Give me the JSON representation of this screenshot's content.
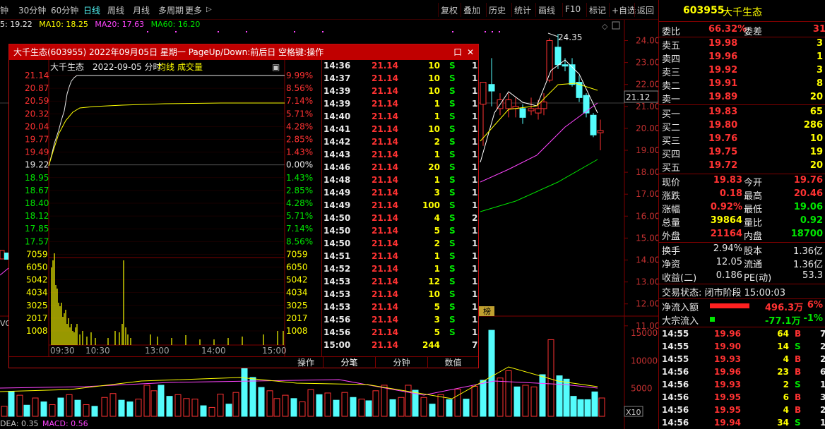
{
  "toolbar": {
    "tabs": [
      "钟",
      "30分钟",
      "60分钟",
      "日线",
      "周线",
      "月线",
      "多周期",
      "更多"
    ],
    "active": "日线",
    "more_arrow": "▷",
    "buttons": [
      "复权",
      "叠加",
      "历史",
      "统计",
      "画线",
      "F10",
      "标记",
      "+自选",
      "返回"
    ]
  },
  "ma_bar": {
    "ma5": "5: 19.22",
    "ma10": "MA10: 18.25",
    "ma20": "MA20: 17.63",
    "ma60": "MA60: 16.20"
  },
  "kline": {
    "price_axis": [
      "24.00",
      "23.00",
      "22.00",
      "21.00",
      "20.00",
      "19.00",
      "18.00",
      "17.00",
      "16.00",
      "15.00",
      "14.00",
      "13.00",
      "12.00",
      "11.00"
    ],
    "current_price_label": "21.12",
    "high_label": "24.35",
    "volume_axis": [
      "15000",
      "10000",
      "5000"
    ],
    "volume_unit": "X10",
    "bang_label": "榜",
    "indicator": {
      "dea": "DEA: 0.35",
      "macd": "MACD: 0.56"
    },
    "vol_left": "VOL",
    "colors": {
      "up": "#ff3232",
      "down": "#54fcfc",
      "ma5": "#ffffff",
      "ma10": "#ffff00",
      "ma20": "#ff44ff",
      "ma60": "#00e600"
    }
  },
  "popup": {
    "title": "大千生态(603955) 2022年09月05日 星期一 PageUp/Down:前后日 空格键:操作",
    "min_btn": "口",
    "close_btn": "✕",
    "intraday": {
      "name": "大千生态",
      "date_label": "2022-09-05 分时",
      "avg_label": "均线",
      "vol_label": "成交量",
      "corner_btn": "▣",
      "left_prices": [
        "21.14",
        "20.87",
        "20.59",
        "20.32",
        "20.04",
        "19.77",
        "19.49",
        "19.22",
        "18.95",
        "18.67",
        "18.40",
        "18.12",
        "17.85",
        "17.57"
      ],
      "right_pct": [
        "9.99%",
        "8.56%",
        "7.14%",
        "5.71%",
        "4.28%",
        "2.85%",
        "1.43%",
        "0.00%",
        "1.43%",
        "2.85%",
        "4.28%",
        "5.71%",
        "7.14%",
        "8.56%"
      ],
      "vol_axis": [
        "7059",
        "6050",
        "5042",
        "4034",
        "3025",
        "2017",
        "1008"
      ],
      "time_axis": [
        "09:30",
        "10:30",
        "13:00",
        "14:00",
        "15:00"
      ]
    },
    "ticks": [
      {
        "time": "14:36",
        "price": "21.14",
        "vol": "10",
        "side": "S",
        "n": "1"
      },
      {
        "time": "14:37",
        "price": "21.14",
        "vol": "10",
        "side": "S",
        "n": "1"
      },
      {
        "time": "14:39",
        "price": "21.14",
        "vol": "10",
        "side": "S",
        "n": "1"
      },
      {
        "time": "14:39",
        "price": "21.14",
        "vol": "1",
        "side": "S",
        "n": "1"
      },
      {
        "time": "14:40",
        "price": "21.14",
        "vol": "1",
        "side": "S",
        "n": "1"
      },
      {
        "time": "14:41",
        "price": "21.14",
        "vol": "10",
        "side": "S",
        "n": "1"
      },
      {
        "time": "14:42",
        "price": "21.14",
        "vol": "2",
        "side": "S",
        "n": "1"
      },
      {
        "time": "14:43",
        "price": "21.14",
        "vol": "1",
        "side": "S",
        "n": "1"
      },
      {
        "time": "14:46",
        "price": "21.14",
        "vol": "20",
        "side": "S",
        "n": "1"
      },
      {
        "time": "14:48",
        "price": "21.14",
        "vol": "1",
        "side": "S",
        "n": "1"
      },
      {
        "time": "14:49",
        "price": "21.14",
        "vol": "3",
        "side": "S",
        "n": "1"
      },
      {
        "time": "14:49",
        "price": "21.14",
        "vol": "100",
        "side": "S",
        "n": "1"
      },
      {
        "time": "14:50",
        "price": "21.14",
        "vol": "4",
        "side": "S",
        "n": "2"
      },
      {
        "time": "14:50",
        "price": "21.14",
        "vol": "5",
        "side": "S",
        "n": "1"
      },
      {
        "time": "14:50",
        "price": "21.14",
        "vol": "2",
        "side": "S",
        "n": "1"
      },
      {
        "time": "14:51",
        "price": "21.14",
        "vol": "1",
        "side": "S",
        "n": "1"
      },
      {
        "time": "14:52",
        "price": "21.14",
        "vol": "1",
        "side": "S",
        "n": "1"
      },
      {
        "time": "14:53",
        "price": "21.14",
        "vol": "12",
        "side": "S",
        "n": "1"
      },
      {
        "time": "14:53",
        "price": "21.14",
        "vol": "10",
        "side": "S",
        "n": "1"
      },
      {
        "time": "14:53",
        "price": "21.14",
        "vol": "5",
        "side": "S",
        "n": "1"
      },
      {
        "time": "14:56",
        "price": "21.14",
        "vol": "3",
        "side": "S",
        "n": "1"
      },
      {
        "time": "14:56",
        "price": "21.14",
        "vol": "5",
        "side": "S",
        "n": "1"
      },
      {
        "time": "15:00",
        "price": "21.14",
        "vol": "244",
        "side": "",
        "n": "7"
      }
    ],
    "tabs": [
      "操作",
      "分笔",
      "分钟",
      "数值"
    ]
  },
  "quote": {
    "code": "603955",
    "name": "大千生态",
    "weibi_label": "委比",
    "weibi": "66.32%",
    "weicha_label": "委差",
    "weicha": "31",
    "asks": [
      {
        "label": "卖五",
        "price": "19.98",
        "vol": "3"
      },
      {
        "label": "卖四",
        "price": "19.96",
        "vol": "1"
      },
      {
        "label": "卖三",
        "price": "19.92",
        "vol": "3"
      },
      {
        "label": "卖二",
        "price": "19.91",
        "vol": "8"
      },
      {
        "label": "卖一",
        "price": "19.89",
        "vol": "20"
      }
    ],
    "bids": [
      {
        "label": "买一",
        "price": "19.83",
        "vol": "65"
      },
      {
        "label": "买二",
        "price": "19.80",
        "vol": "286"
      },
      {
        "label": "买三",
        "price": "19.76",
        "vol": "10"
      },
      {
        "label": "买四",
        "price": "19.75",
        "vol": "19"
      },
      {
        "label": "买五",
        "price": "19.72",
        "vol": "20"
      }
    ],
    "stats": [
      {
        "l1": "现价",
        "v1": "19.83",
        "c1": "red",
        "l2": "今开",
        "v2": "19.76",
        "c2": "red"
      },
      {
        "l1": "涨跌",
        "v1": "0.18",
        "c1": "red",
        "l2": "最高",
        "v2": "20.46",
        "c2": "red"
      },
      {
        "l1": "涨幅",
        "v1": "0.92%",
        "c1": "red",
        "l2": "最低",
        "v2": "19.06",
        "c2": "green"
      },
      {
        "l1": "总量",
        "v1": "39864",
        "c1": "yellow",
        "l2": "量比",
        "v2": "0.92",
        "c2": "green"
      },
      {
        "l1": "外盘",
        "v1": "21164",
        "c1": "red",
        "l2": "内盘",
        "v2": "18700",
        "c2": "green"
      }
    ],
    "stats2": [
      {
        "l1": "换手",
        "v1": "2.94%",
        "l2": "股本",
        "v2": "1.36亿"
      },
      {
        "l1": "净资",
        "v1": "12.05",
        "l2": "流通",
        "v2": "1.36亿"
      },
      {
        "l1": "收益(二)",
        "v1": "0.186",
        "l2": "PE(动)",
        "v2": "53.3"
      }
    ],
    "trade_status": "交易状态: 闭市阶段 15:00:03",
    "net_inflow_label": "净流入额",
    "net_inflow": "496.3万",
    "net_inflow_pct": "6%",
    "block_inflow_label": "大宗流入",
    "block_inflow": "-77.1万",
    "block_inflow_pct": "-1%",
    "ticks": [
      {
        "time": "14:55",
        "price": "19.96",
        "vol": "64",
        "side": "B",
        "n": "7"
      },
      {
        "time": "14:55",
        "price": "19.90",
        "vol": "14",
        "side": "S",
        "n": "2"
      },
      {
        "time": "14:55",
        "price": "19.93",
        "vol": "4",
        "side": "B",
        "n": "2"
      },
      {
        "time": "14:56",
        "price": "19.96",
        "vol": "23",
        "side": "B",
        "n": "6"
      },
      {
        "time": "14:56",
        "price": "19.93",
        "vol": "2",
        "side": "S",
        "n": "1"
      },
      {
        "time": "14:56",
        "price": "19.95",
        "vol": "6",
        "side": "B",
        "n": "3"
      },
      {
        "time": "14:56",
        "price": "19.95",
        "vol": "4",
        "side": "B",
        "n": "2"
      },
      {
        "time": "14:56",
        "price": "19.94",
        "vol": "34",
        "side": "S",
        "n": "1"
      }
    ]
  }
}
